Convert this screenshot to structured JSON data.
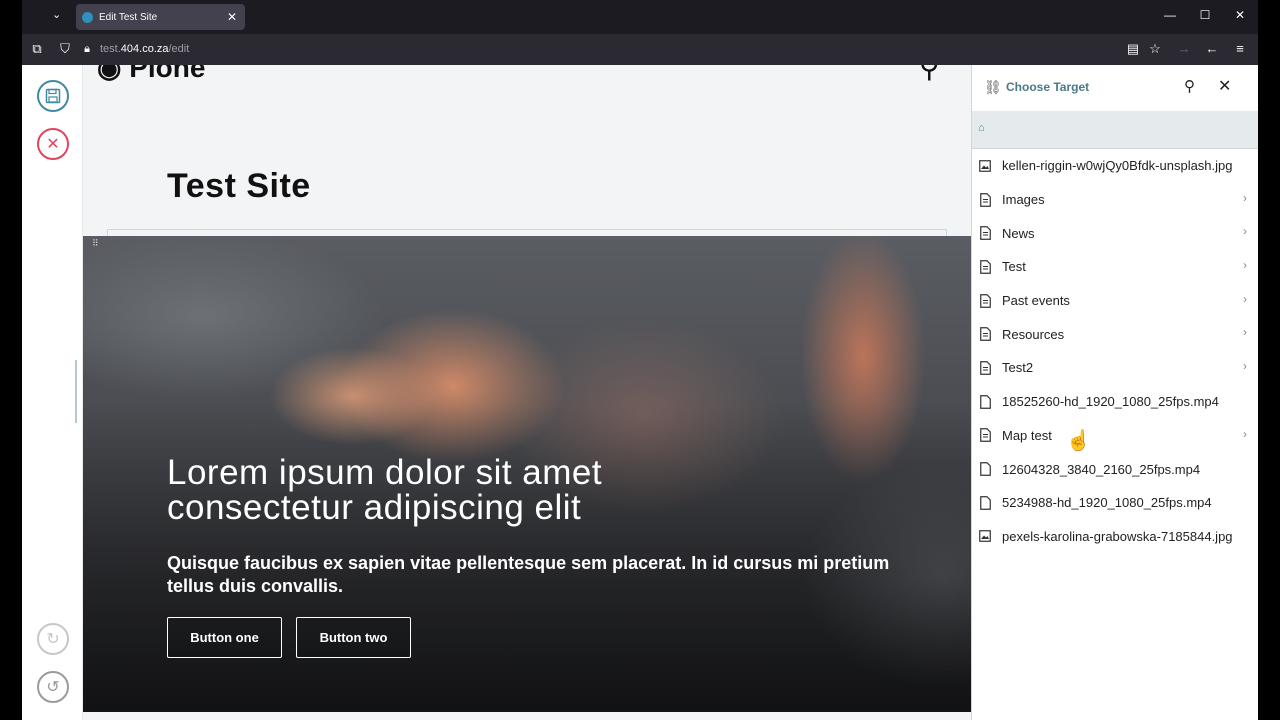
{
  "browser": {
    "tab_title": "Edit Test Site",
    "url_prefix": "test.",
    "url_host": "404.co.za",
    "url_path": "/edit",
    "icons": [
      "tab-list-icon",
      "close-tab-icon",
      "minimize-icon",
      "maximize-icon",
      "close-window-icon",
      "extensions-icon",
      "shield-icon",
      "lock-icon",
      "reader-mode-icon",
      "bookmark-star-icon",
      "forward-icon",
      "back-icon",
      "menu-icon"
    ]
  },
  "toolbar": {
    "save_icon": "save-icon",
    "cancel_icon": "cancel-icon",
    "redo_icon": "redo-icon",
    "undo_icon": "undo-icon",
    "accent_save": "#3f8aa0",
    "accent_cancel": "#e0455e"
  },
  "page": {
    "logo_fragment": "Plone",
    "site_title": "Test Site"
  },
  "hero": {
    "title_line1": "Lorem ipsum dolor sit amet",
    "title_line2": "consectetur adipiscing elit",
    "subtitle": "Quisque faucibus ex sapien vitae pellentesque sem placerat. In id cursus mi pretium tellus duis convallis.",
    "button_one": "Button one",
    "button_two": "Button two"
  },
  "sidebar": {
    "title": "Choose Target",
    "items": [
      {
        "label": "kellen-riggin-w0wjQy0Bfdk-unsplash.jpg",
        "icon": "image-icon",
        "folder": false
      },
      {
        "label": "Images",
        "icon": "page-icon",
        "folder": true
      },
      {
        "label": "News",
        "icon": "page-icon",
        "folder": true
      },
      {
        "label": "Test",
        "icon": "page-icon",
        "folder": true
      },
      {
        "label": "Past events",
        "icon": "page-icon",
        "folder": true
      },
      {
        "label": "Resources",
        "icon": "page-icon",
        "folder": true
      },
      {
        "label": "Test2",
        "icon": "page-icon",
        "folder": true
      },
      {
        "label": "18525260-hd_1920_1080_25fps.mp4",
        "icon": "file-icon",
        "folder": false
      },
      {
        "label": "Map test",
        "icon": "page-icon",
        "folder": true
      },
      {
        "label": "12604328_3840_2160_25fps.mp4",
        "icon": "file-icon",
        "folder": false
      },
      {
        "label": "5234988-hd_1920_1080_25fps.mp4",
        "icon": "file-icon",
        "folder": false
      },
      {
        "label": "pexels-karolina-grabowska-7185844.jpg",
        "icon": "image-icon",
        "folder": false
      }
    ]
  }
}
